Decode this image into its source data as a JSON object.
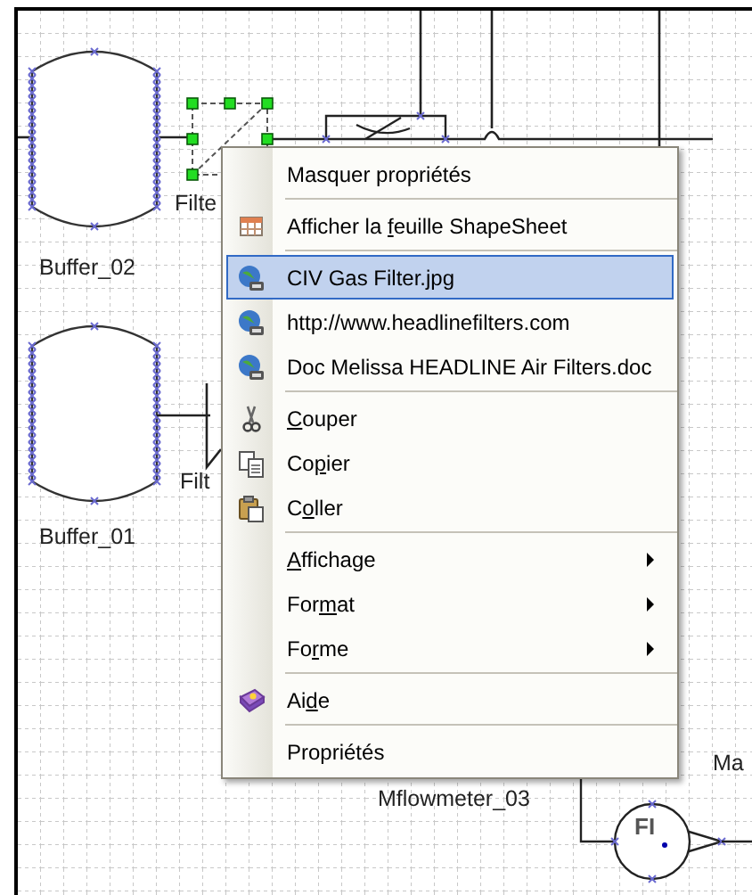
{
  "diagram": {
    "labels": [
      {
        "text": "Buffer_02"
      },
      {
        "text": "Filte"
      },
      {
        "text": "Buffer_01"
      },
      {
        "text": "Filt"
      },
      {
        "text": "Mflowmeter_03"
      },
      {
        "text": "Ma"
      }
    ],
    "flowmeter": {
      "tag": "FI"
    }
  },
  "context_menu": {
    "items": [
      {
        "kind": "item",
        "before": "Masquer propriétés",
        "selected": false
      },
      {
        "kind": "separator"
      },
      {
        "kind": "sheet",
        "before": "Afficher la ",
        "key": "f",
        "after": "euille ShapeSheet",
        "selected": false
      },
      {
        "kind": "separator"
      },
      {
        "kind": "link",
        "before": "CIV Gas Filter.jpg",
        "selected": true
      },
      {
        "kind": "link",
        "before": "http://www.headlinefilters.com",
        "selected": false
      },
      {
        "kind": "link",
        "before": "Doc Melissa HEADLINE Air Filters.doc",
        "selected": false
      },
      {
        "kind": "separator"
      },
      {
        "kind": "cut",
        "key": "C",
        "after": "ouper",
        "selected": false
      },
      {
        "kind": "copy",
        "before": "Co",
        "key": "p",
        "after": "ier",
        "selected": false
      },
      {
        "kind": "paste",
        "before": "C",
        "key": "o",
        "after": "ller",
        "selected": false
      },
      {
        "kind": "separator"
      },
      {
        "kind": "submenu",
        "key": "A",
        "after": "ffichage",
        "selected": false
      },
      {
        "kind": "submenu",
        "before": "For",
        "key": "m",
        "after": "at",
        "selected": false
      },
      {
        "kind": "submenu",
        "before": "Fo",
        "key": "r",
        "after": "me",
        "selected": false
      },
      {
        "kind": "separator"
      },
      {
        "kind": "help",
        "before": "Ai",
        "key": "d",
        "after": "e",
        "selected": false
      },
      {
        "kind": "separator"
      },
      {
        "kind": "item",
        "before": "Propriétés",
        "selected": false
      }
    ]
  }
}
